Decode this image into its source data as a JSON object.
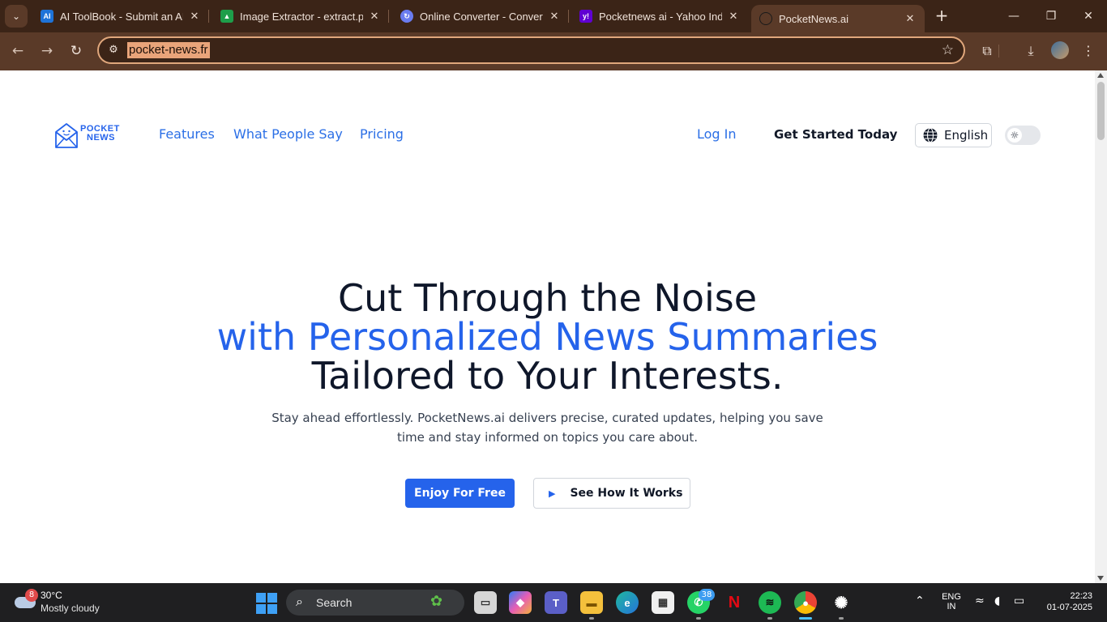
{
  "browser": {
    "tabs": [
      {
        "title": "AI ToolBook - Submit an AI",
        "favicon": "aitoolbook-icon",
        "color": "#1e73d8"
      },
      {
        "title": "Image Extractor - extract.pic",
        "favicon": "image-extractor-icon",
        "color": "#1e9e4a"
      },
      {
        "title": "Online Converter - Convert I",
        "favicon": "converter-icon",
        "color": "#6a7cf0"
      },
      {
        "title": "Pocketnews ai - Yahoo India",
        "favicon": "yahoo-icon",
        "color": "#6001d2"
      },
      {
        "title": "PocketNews.ai",
        "favicon": "pocketnews-icon",
        "color": "#2a2a2a"
      }
    ],
    "url": "pocket-news.fr",
    "accent": "#e9a47a"
  },
  "site": {
    "logo": {
      "line1": "POCKET",
      "line2": "NEWS"
    },
    "nav": {
      "features": "Features",
      "what_people_say": "What People Say",
      "pricing": "Pricing",
      "login": "Log In",
      "get_started": "Get Started Today",
      "language": "English"
    },
    "hero": {
      "line1": "Cut Through the Noise",
      "line2": "with Personalized News Summaries",
      "line3": "Tailored to Your Interests.",
      "subtitle_line1": "Stay ahead effortlessly. PocketNews.ai delivers precise, curated updates, helping you save",
      "subtitle_line2": "time and stay informed on topics you care about.",
      "cta_primary": "Enjoy For Free",
      "cta_secondary": "See How It Works"
    },
    "colors": {
      "brand": "#2563eb",
      "text": "#0f172a"
    }
  },
  "taskbar": {
    "weather": {
      "temp": "30°C",
      "condition": "Mostly cloudy",
      "badge": "8"
    },
    "search_label": "Search",
    "whatsapp_badge": "38",
    "lang_top": "ENG",
    "lang_bottom": "IN",
    "time": "22:23",
    "date": "01-07-2025"
  }
}
